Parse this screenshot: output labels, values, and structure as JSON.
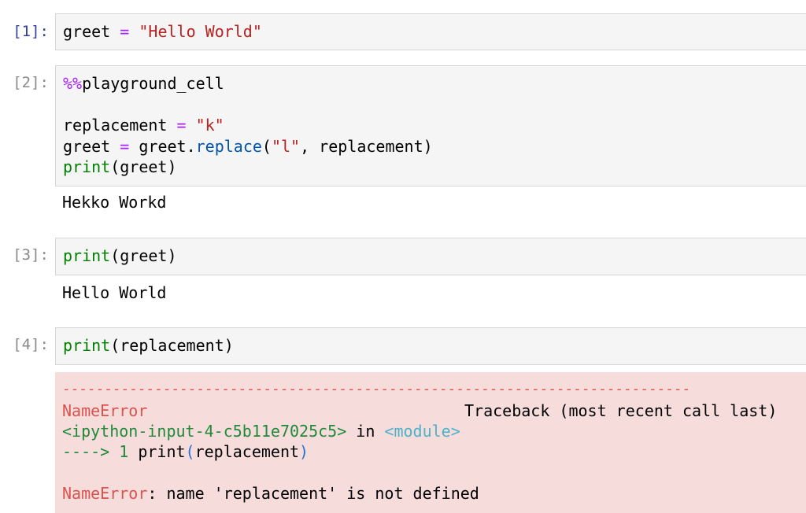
{
  "cells": [
    {
      "prompt": "[1]:",
      "code": {
        "var": "greet",
        "op": "=",
        "str": "\"Hello World\""
      }
    },
    {
      "prompt": "[2]:",
      "code": {
        "magic_sym": "%%",
        "magic_name": "playground_cell",
        "l2_var": "replacement",
        "l2_op": "=",
        "l2_str": "\"k\"",
        "l3_var": "greet",
        "l3_op": "=",
        "l3_obj": "greet.",
        "l3_meth": "replace",
        "l3_open": "(",
        "l3_str": "\"l\"",
        "l3_rest": ", replacement)",
        "l4_fn": "print",
        "l4_rest": "(greet)"
      },
      "output": "Hekko Workd"
    },
    {
      "prompt": "[3]:",
      "code": {
        "fn": "print",
        "rest": "(greet)"
      },
      "output": "Hello World"
    },
    {
      "prompt": "[4]:",
      "code": {
        "fn": "print",
        "rest": "(replacement)"
      },
      "error": {
        "dashes": "---------------------------------------------------------------------------",
        "name": "NameError",
        "traceback": "Traceback (most recent call last)",
        "location": "<ipython-input-4-c5b11e7025c5>",
        "in_word": " in ",
        "module": "<module>",
        "arrow": "----> 1 ",
        "arrow_fn": "print",
        "arrow_open": "(",
        "arrow_arg": "replacement",
        "arrow_close": ")",
        "final_name": "NameError",
        "final_msg": ": name 'replacement' is not defined"
      }
    }
  ]
}
